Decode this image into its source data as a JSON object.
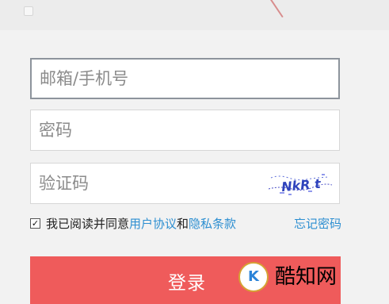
{
  "form": {
    "email_placeholder": "邮箱/手机号",
    "password_placeholder": "密码",
    "captcha_placeholder": "验证码",
    "captcha_text": "NkR t"
  },
  "agreement": {
    "prefix": "我已阅读并同意",
    "user_agreement": "用户协议",
    "connector": "和",
    "privacy_terms": "隐私条款",
    "forgot_password": "忘记密码",
    "checked": true
  },
  "actions": {
    "login_label": "登录"
  },
  "watermark": {
    "text": "酷知网"
  },
  "colors": {
    "button": "#ef5b5b",
    "link": "#2d8fd1",
    "text": "#222222",
    "border": "#d7d7d7"
  },
  "icons": {
    "checkbox": "check-icon",
    "watermark_logo": "watermark-logo-icon"
  }
}
